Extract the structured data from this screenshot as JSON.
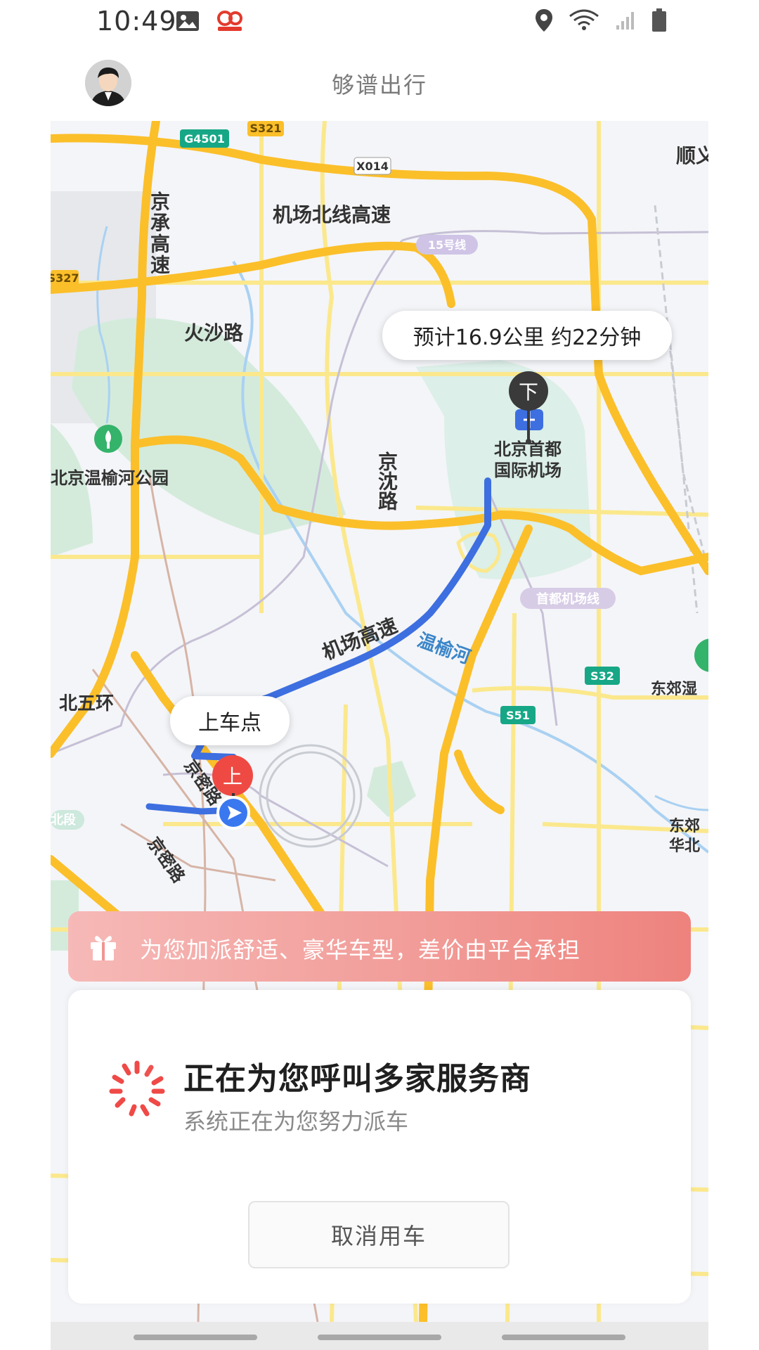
{
  "status_bar": {
    "time": "10:49",
    "left_icons": [
      "gallery-icon",
      "go-app-icon"
    ],
    "right_icons": [
      "location-icon",
      "wifi-icon",
      "signal-icon",
      "battery-icon"
    ]
  },
  "header": {
    "title": "够谱出行",
    "avatar": "user-avatar"
  },
  "map": {
    "route_info": "预计16.9公里 约22分钟",
    "pickup_bubble": "上车点",
    "pickup_marker": "上",
    "dropoff_marker": "下",
    "labels": {
      "airport_north_expressway": "机场北线高速",
      "jingcheng_expressway": "京承高速",
      "huosha_road": "火沙路",
      "wenyuhe_park": "北京温榆河公园",
      "jingshun_road": "京沈路",
      "capital_airport": "北京首都国际机场",
      "airport_expressway": "机场高速",
      "wenyu_river": "温榆河",
      "north_fifth_ring": "北五环",
      "jingmi_road_1": "京密路",
      "jingmi_road_2": "京密路",
      "shunyi": "顺义",
      "dongjiao": "东郊湿",
      "dongjiao_huabei": "东郊华北",
      "line15": "15号线",
      "airport_line": "首都机场线",
      "g4501": "G4501",
      "s321": "S321",
      "x014": "X014",
      "s327": "S327",
      "s32": "S32",
      "s51": "S51",
      "north_section": "北段"
    },
    "colors": {
      "route": "#3d6fe0",
      "highway": "#fbbf2a",
      "road": "#fbe88c",
      "green": "#cfe9d9",
      "river": "#a9d1f2"
    }
  },
  "promo": {
    "text": "为您加派舒适、豪华车型，差价由平台承担",
    "icon": "gift-icon"
  },
  "card": {
    "title": "正在为您呼叫多家服务商",
    "subtitle": "系统正在为您努力派车",
    "cancel_label": "取消用车",
    "spinner_color": "#ef4a47"
  }
}
